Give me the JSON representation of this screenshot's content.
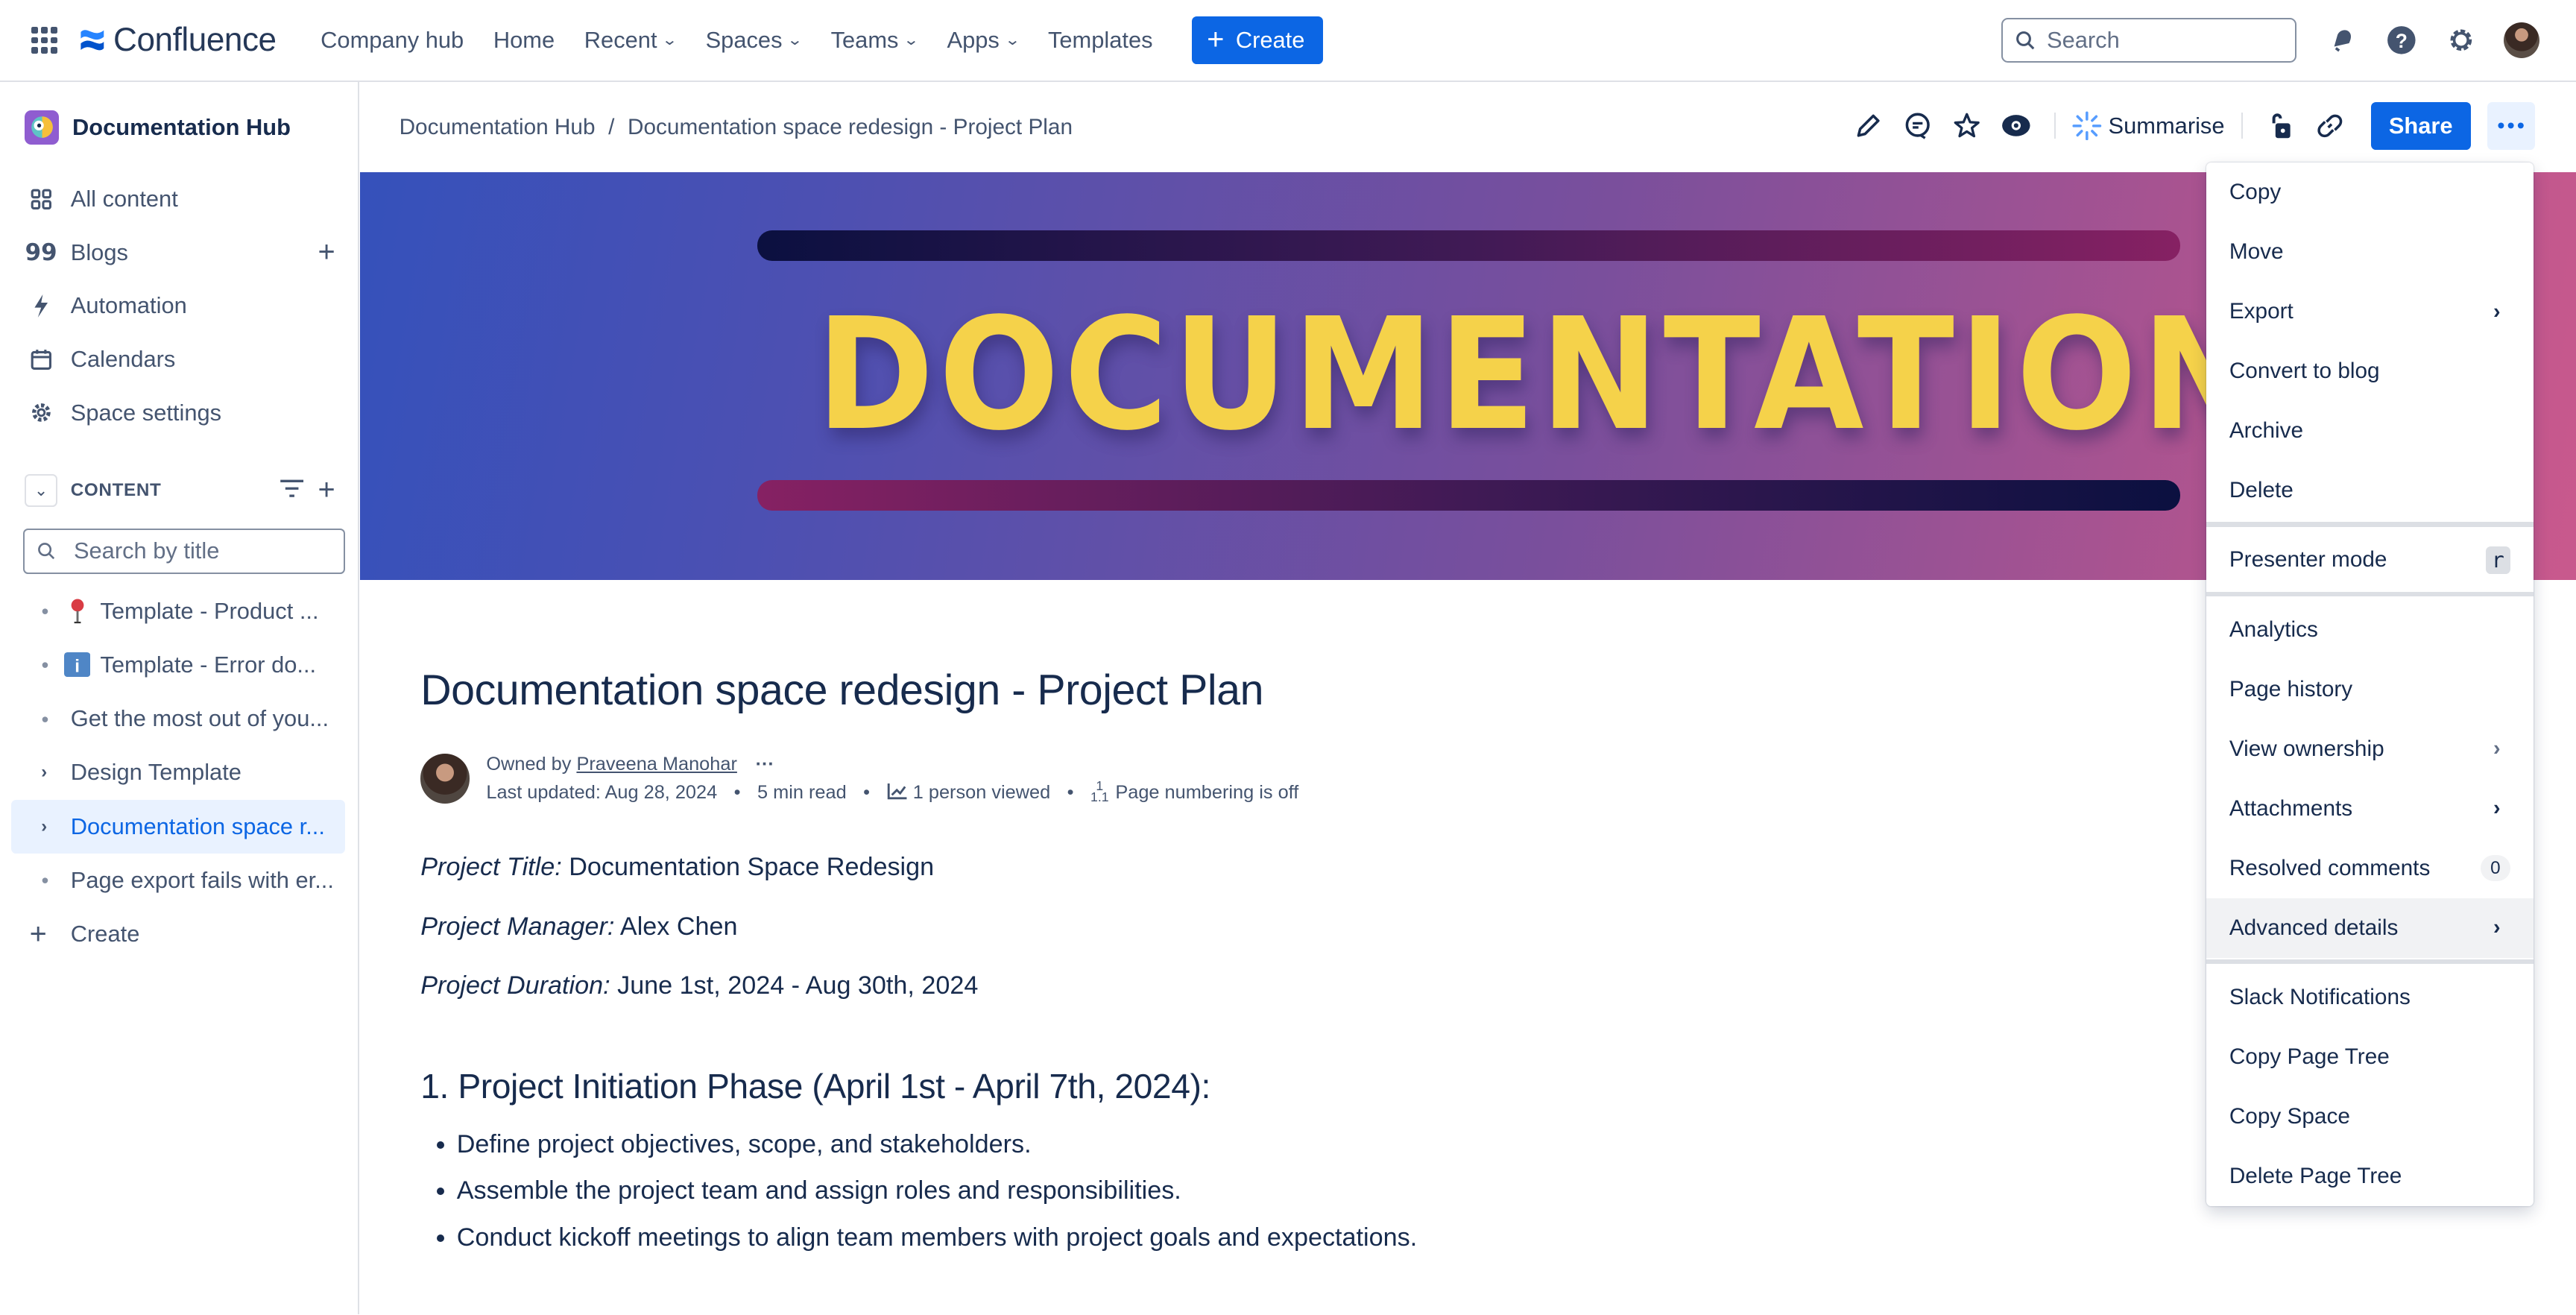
{
  "topnav": {
    "product_name": "Confluence",
    "links": [
      {
        "label": "Company hub",
        "dropdown": false
      },
      {
        "label": "Home",
        "dropdown": false
      },
      {
        "label": "Recent",
        "dropdown": true
      },
      {
        "label": "Spaces",
        "dropdown": true
      },
      {
        "label": "Teams",
        "dropdown": true
      },
      {
        "label": "Apps",
        "dropdown": true
      },
      {
        "label": "Templates",
        "dropdown": false
      }
    ],
    "create_label": "Create",
    "search_placeholder": "Search",
    "icons": [
      "notifications-icon",
      "help-icon",
      "settings-icon",
      "profile-avatar"
    ],
    "accent_color": "#0c66e4"
  },
  "sidebar": {
    "space_name": "Documentation Hub",
    "items": [
      {
        "label": "All content",
        "icon": "all-content-icon"
      },
      {
        "label": "Blogs",
        "icon": "quote-icon",
        "has_add": true
      },
      {
        "label": "Automation",
        "icon": "lightning-icon"
      },
      {
        "label": "Calendars",
        "icon": "calendar-icon"
      },
      {
        "label": "Space settings",
        "icon": "gear-icon"
      }
    ],
    "content_section": {
      "label": "CONTENT",
      "search_placeholder": "Search by title",
      "tree": [
        {
          "label": "Template - Product ...",
          "prefix": "bullet",
          "emoji": "📍"
        },
        {
          "label": "Template - Error do...",
          "prefix": "bullet",
          "emoji": "ℹ️"
        },
        {
          "label": "Get the most out of you...",
          "prefix": "bullet"
        },
        {
          "label": "Design Template",
          "prefix": "chevron"
        },
        {
          "label": "Documentation space r...",
          "prefix": "chevron",
          "selected": true
        },
        {
          "label": "Page export fails with er...",
          "prefix": "bullet"
        }
      ],
      "create_label": "Create"
    }
  },
  "page_header": {
    "breadcrumb": [
      "Documentation Hub",
      "Documentation space redesign - Project Plan"
    ],
    "summarise_label": "Summarise",
    "share_label": "Share"
  },
  "banner": {
    "text": "DOCUMENTATION"
  },
  "page": {
    "title": "Documentation space redesign - Project Plan",
    "byline": {
      "owned_by_prefix": "Owned by",
      "owner": "Praveena Manohar",
      "last_updated": "Last updated: Aug 28, 2024",
      "read_time": "5 min read",
      "views": "1 person viewed",
      "page_numbering": "Page numbering is off"
    },
    "properties": [
      {
        "label": "Project Title:",
        "value": "Documentation Space Redesign"
      },
      {
        "label": "Project Manager:",
        "value": "Alex Chen"
      },
      {
        "label": "Project Duration:",
        "value": "June 1st, 2024 - Aug 30th, 2024"
      }
    ],
    "section_heading": "1. Project Initiation Phase (April 1st - April 7th, 2024):",
    "bullets": [
      "Define project objectives, scope, and stakeholders.",
      "Assemble the project team and assign roles and responsibilities.",
      "Conduct kickoff meetings to align team members with project goals and expectations."
    ]
  },
  "more_menu": {
    "group1": [
      {
        "label": "Copy"
      },
      {
        "label": "Move"
      },
      {
        "label": "Export",
        "submenu": true
      },
      {
        "label": "Convert to blog"
      },
      {
        "label": "Archive"
      },
      {
        "label": "Delete"
      }
    ],
    "group2": [
      {
        "label": "Presenter mode",
        "shortcut": "r"
      }
    ],
    "group3": [
      {
        "label": "Analytics"
      },
      {
        "label": "Page history"
      },
      {
        "label": "View ownership",
        "submenu": true
      },
      {
        "label": "Attachments",
        "submenu": true
      },
      {
        "label": "Resolved comments",
        "badge": "0"
      },
      {
        "label": "Advanced details",
        "submenu": true,
        "hovered": true
      }
    ],
    "group4": [
      {
        "label": "Slack Notifications"
      },
      {
        "label": "Copy Page Tree"
      },
      {
        "label": "Copy Space"
      },
      {
        "label": "Delete Page Tree"
      }
    ]
  }
}
